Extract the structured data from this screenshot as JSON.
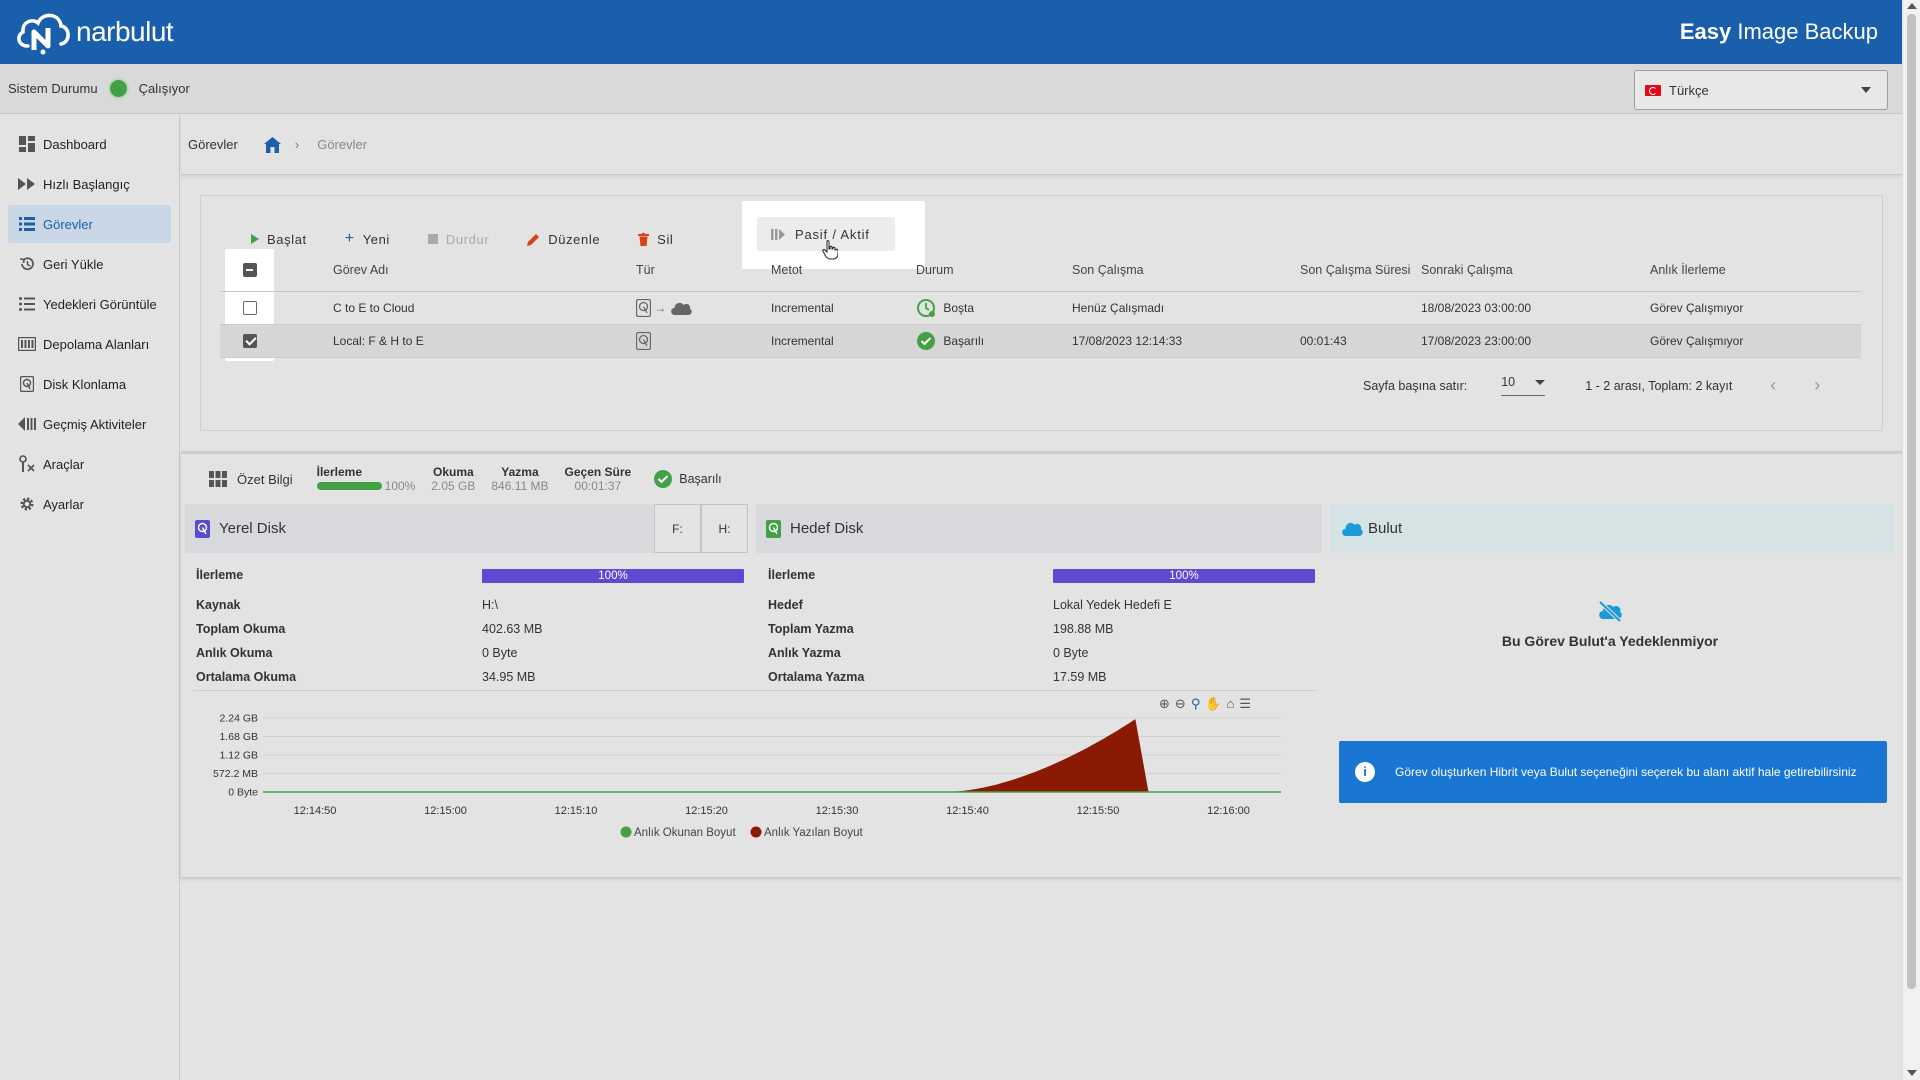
{
  "header": {
    "logo_text": "narbulut",
    "app_title_bold": "Easy",
    "app_title_rest": " Image Backup"
  },
  "status": {
    "label": "Sistem Durumu",
    "value": "Çalışıyor",
    "status_color": "#43a047",
    "language": "Türkçe"
  },
  "sidebar": {
    "items": [
      {
        "label": "Dashboard",
        "icon": "dashboard-icon"
      },
      {
        "label": "Hızlı Başlangıç",
        "icon": "fast-forward-icon"
      },
      {
        "label": "Görevler",
        "icon": "list-icon",
        "active": true
      },
      {
        "label": "Geri Yükle",
        "icon": "restore-icon"
      },
      {
        "label": "Yedekleri Görüntüle",
        "icon": "list-view-icon"
      },
      {
        "label": "Depolama Alanları",
        "icon": "storage-icon"
      },
      {
        "label": "Disk Klonlama",
        "icon": "disk-icon"
      },
      {
        "label": "Geçmiş Aktiviteler",
        "icon": "history-icon"
      },
      {
        "label": "Araçlar",
        "icon": "tools-icon"
      },
      {
        "label": "Ayarlar",
        "icon": "gear-icon"
      }
    ]
  },
  "breadcrumb": {
    "page": "Görevler",
    "current": "Görevler"
  },
  "toolbar": {
    "start": "Başlat",
    "new": "Yeni",
    "stop": "Durdur",
    "edit": "Düzenle",
    "delete": "Sil",
    "toggle": "Pasif / Aktif"
  },
  "table": {
    "columns": {
      "name": "Görev Adı",
      "type": "Tür",
      "method": "Metot",
      "status": "Durum",
      "last_run": "Son Çalışma",
      "last_duration": "Son Çalışma Süresi",
      "next_run": "Sonraki Çalışma",
      "progress": "Anlık İlerleme"
    },
    "rows": [
      {
        "name": "C to E to Cloud",
        "method": "Incremental",
        "status": "Boşta",
        "last_run": "Henüz Çalışmadı",
        "last_duration": "",
        "next_run": "18/08/2023 03:00:00",
        "progress": "Görev Çalışmıyor"
      },
      {
        "name": "Local: F & H to E",
        "method": "Incremental",
        "status": "Başarılı",
        "last_run": "17/08/2023 12:14:33",
        "last_duration": "00:01:43",
        "next_run": "17/08/2023 23:00:00",
        "progress": "Görev Çalışmıyor"
      }
    ]
  },
  "pager": {
    "rows_label": "Sayfa başına satır:",
    "per_page": "10",
    "range": "1 - 2 arası, Toplam: 2 kayıt"
  },
  "summary": {
    "title": "Özet Bilgi",
    "progress_label": "İlerleme",
    "progress_value": "100%",
    "progress_fraction": 1.0,
    "read_label": "Okuma",
    "read_value": "2.05 GB",
    "write_label": "Yazma",
    "write_value": "846.11 MB",
    "elapsed_label": "Geçen Süre",
    "elapsed_value": "00:01:37",
    "status": "Başarılı"
  },
  "local_disk": {
    "title": "Yerel Disk",
    "tabs": [
      "F:",
      "H:"
    ],
    "progress_label": "İlerleme",
    "progress": "100%",
    "source_label": "Kaynak",
    "source": "H:\\",
    "total_read_label": "Toplam Okuma",
    "total_read": "402.63 MB",
    "instant_read_label": "Anlık Okuma",
    "instant_read": "0 Byte",
    "avg_read_label": "Ortalama Okuma",
    "avg_read": "34.95 MB"
  },
  "target_disk": {
    "title": "Hedef Disk",
    "progress_label": "İlerleme",
    "progress": "100%",
    "target_label": "Hedef",
    "target": "Lokal Yedek Hedefi E",
    "total_write_label": "Toplam Yazma",
    "total_write": "198.88 MB",
    "instant_write_label": "Anlık Yazma",
    "instant_write": "0 Byte",
    "avg_write_label": "Ortalama Yazma",
    "avg_write": "17.59 MB"
  },
  "cloud": {
    "title": "Bulut",
    "not_backed": "Bu Görev Bulut'a Yedeklenmiyor",
    "info": "Görev oluşturken Hibrit veya Bulut seçeneğini seçerek bu alanı aktif hale getirebilirsiniz"
  },
  "chart_data": {
    "type": "area",
    "y_ticks": [
      "2.24 GB",
      "1.68 GB",
      "1.12 GB",
      "572.2 MB",
      "0 Byte"
    ],
    "x_ticks": [
      "12:14:50",
      "12:15:00",
      "12:15:10",
      "12:15:20",
      "12:15:30",
      "12:15:40",
      "12:15:50",
      "12:16:00"
    ],
    "series": [
      {
        "name": "Anlık Okunan Boyut",
        "color": "#43a047"
      },
      {
        "name": "Anlık Yazılan Boyut",
        "color": "#8b1a05"
      }
    ]
  }
}
